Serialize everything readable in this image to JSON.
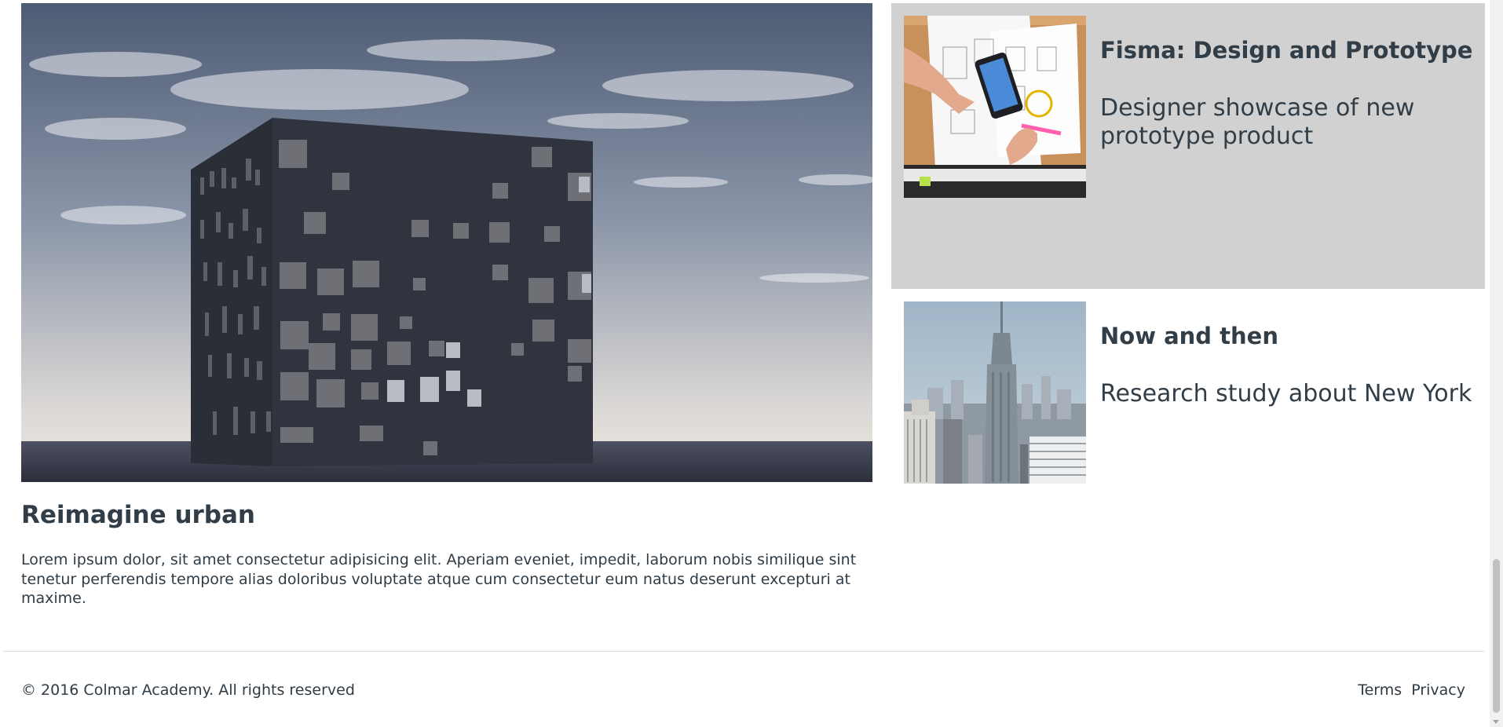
{
  "featured": {
    "image_alt": "Black cube building with scattered windows under a cloudy sky",
    "title": "Reimagine urban",
    "body": "Lorem ipsum dolor, sit amet consectetur adipisicing elit. Aperiam eveniet, impedit, laborum nobis similique sint tenetur perferendis tempore alias doloribus voluptate atque cum consectetur eum natus deserunt excepturi at maxime."
  },
  "side_cards": [
    {
      "title": "Fisma: Design and Prototype",
      "description": "Designer showcase of new prototype product",
      "highlighted": true,
      "image_alt": "Hands sketching app wireframes next to a smartphone"
    },
    {
      "title": "Now and then",
      "description": "Research study about New York",
      "highlighted": false,
      "image_alt": "New York skyline with the Empire State Building"
    }
  ],
  "footer": {
    "copyright": "© 2016 Colmar Academy. All rights reserved",
    "links": [
      "Terms",
      "Privacy"
    ]
  },
  "colors": {
    "text": "#313d47",
    "highlight_bg": "#d1d1d1",
    "divider": "#dcdcdc"
  }
}
